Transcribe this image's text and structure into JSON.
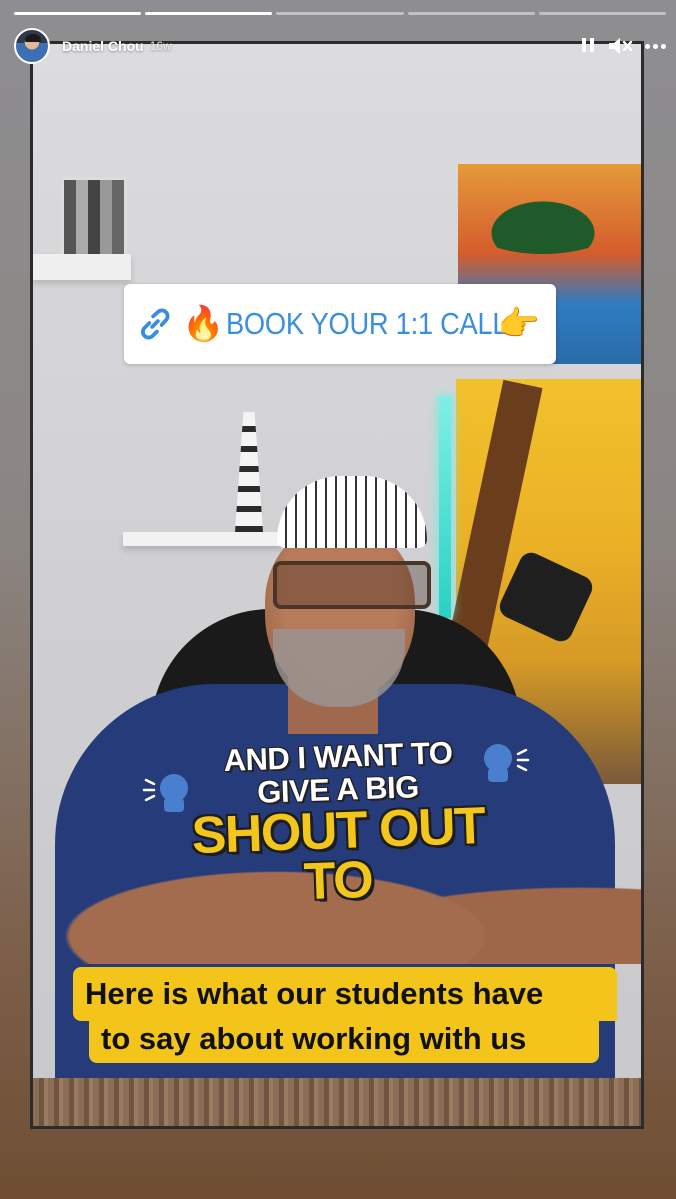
{
  "story": {
    "progress": [
      1,
      1,
      0,
      0,
      0
    ],
    "user": {
      "name": "Daniel Chou",
      "time_ago": "16w"
    },
    "controls": {
      "pause_icon": "pause-icon",
      "mute_icon": "speaker-muted-icon",
      "more_icon": "more-dots-icon"
    }
  },
  "link_sticker": {
    "emoji_left": "🔥",
    "text": "BOOK YOUR 1:1 CALL",
    "emoji_right": "👉",
    "icon": "link-icon"
  },
  "caption": {
    "line1": "AND I WANT TO",
    "line2": "GIVE A BIG",
    "line3": "SHOUT OUT",
    "line4": "TO"
  },
  "subtitle": {
    "line1": "Here is what our students have",
    "line2": "to say about working with us"
  },
  "colors": {
    "link_blue": "#3a8ee0",
    "caption_yellow": "#f3c61b",
    "subtitle_bg": "#f3c51a",
    "shirt": "#263c7a"
  }
}
